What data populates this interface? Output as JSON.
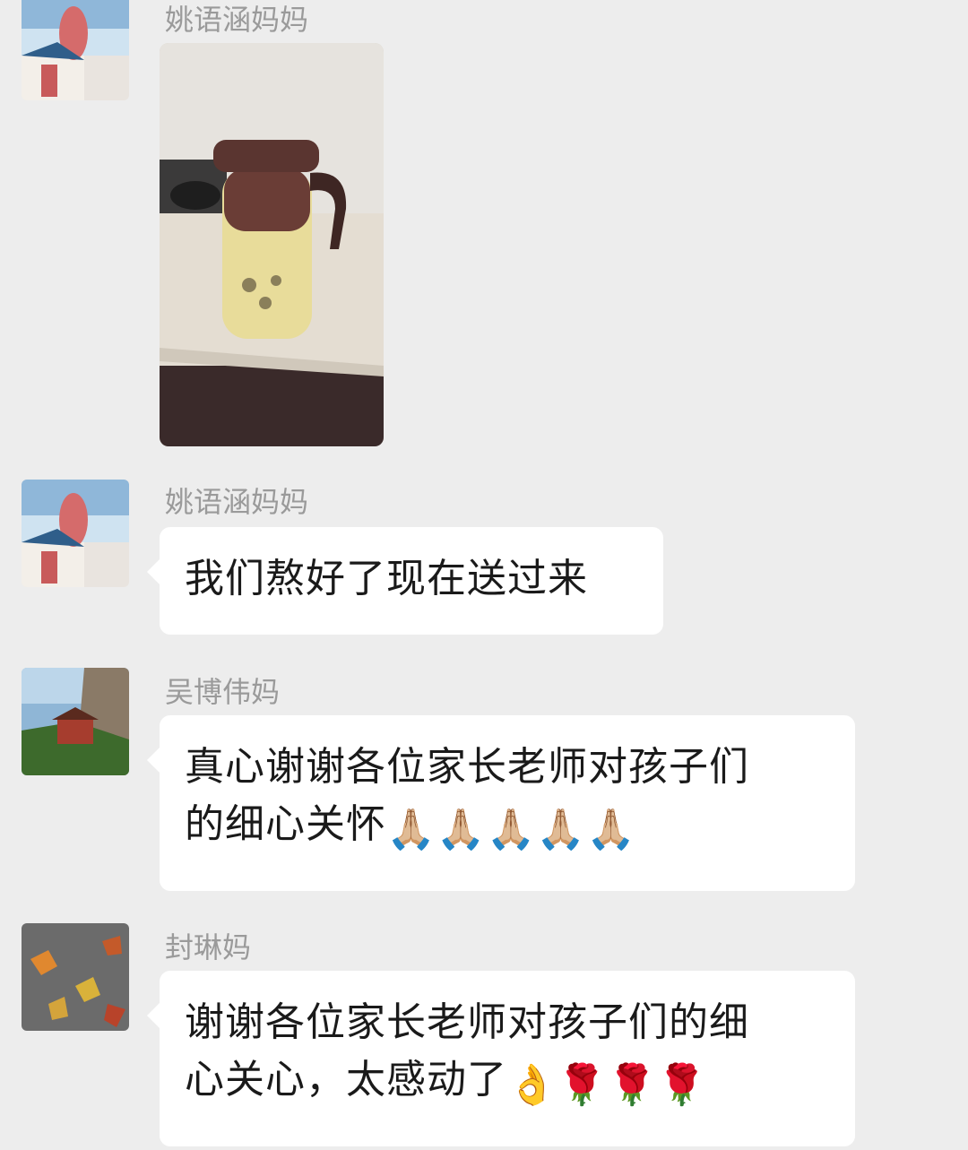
{
  "messages": [
    {
      "sender": "姚语涵妈妈",
      "type": "image",
      "image_desc": "thermos-photo"
    },
    {
      "sender": "姚语涵妈妈",
      "type": "text",
      "text": "我们熬好了现在送过来"
    },
    {
      "sender": "吴博伟妈",
      "type": "text",
      "text_line1": "真心谢谢各位家长老师对孩子们",
      "text_line2": "的细心关怀",
      "emoji_line2": "🙏🏼🙏🏼🙏🏼🙏🏼🙏🏼"
    },
    {
      "sender": "封琳妈",
      "type": "text",
      "text_line1": "谢谢各位家长老师对孩子们的细",
      "text_line2": "心关心，太感动了",
      "emoji_line2": "👌🌹🌹🌹"
    }
  ],
  "colors": {
    "background": "#ededed",
    "bubble": "#ffffff",
    "sender_text": "#9a9a9a",
    "message_text": "#1a1a1a"
  }
}
